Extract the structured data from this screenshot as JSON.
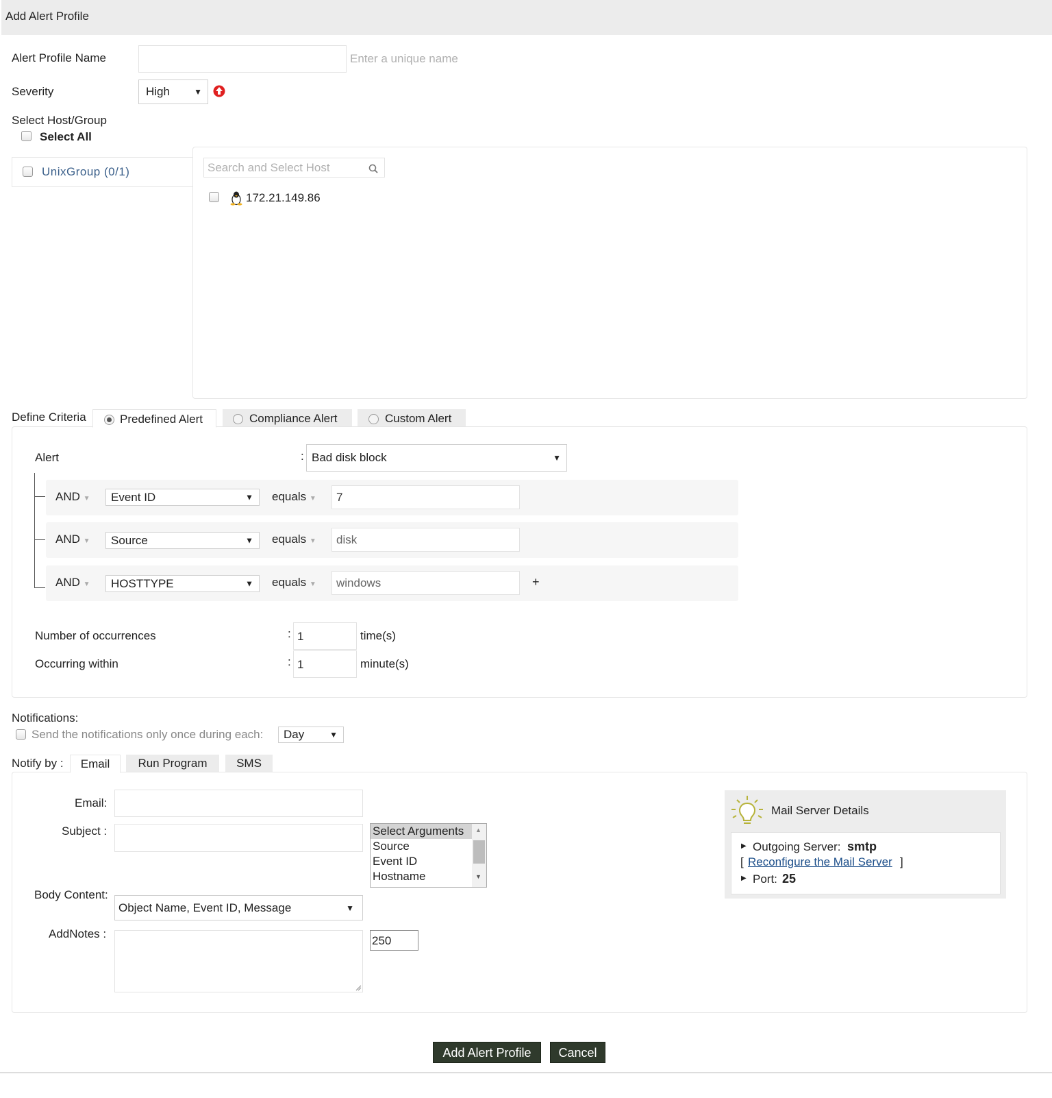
{
  "header": {
    "title": "Add Alert Profile"
  },
  "form": {
    "profile_name_label": "Alert Profile Name",
    "profile_name_value": "",
    "profile_name_hint": "Enter a unique name",
    "severity_label": "Severity",
    "severity_value": "High",
    "select_host_label": "Select Host/Group",
    "select_all_label": "Select All"
  },
  "groups": [
    {
      "label": "UnixGroup (0/1)"
    }
  ],
  "hosts": {
    "search_placeholder": "Search and Select Host",
    "items": [
      {
        "label": "172.21.149.86",
        "os": "linux"
      }
    ]
  },
  "criteria": {
    "label": "Define Criteria",
    "tabs": [
      {
        "label": "Predefined Alert",
        "selected": true
      },
      {
        "label": "Compliance Alert",
        "selected": false
      },
      {
        "label": "Custom Alert",
        "selected": false
      }
    ],
    "alert_label": "Alert",
    "alert_value": "Bad disk block",
    "conditions": [
      {
        "join": "AND",
        "field": "Event ID",
        "op": "equals",
        "value": "7"
      },
      {
        "join": "AND",
        "field": "Source",
        "op": "equals",
        "value": "disk"
      },
      {
        "join": "AND",
        "field": "HOSTTYPE",
        "op": "equals",
        "value": "windows"
      }
    ],
    "add_symbol": "+",
    "occurrences_label": "Number of occurrences",
    "occurrences_value": "1",
    "occurrences_unit": "time(s)",
    "within_label": "Occurring within",
    "within_value": "1",
    "within_unit": "minute(s)",
    "colon": ":"
  },
  "notifications": {
    "label": "Notifications:",
    "once_label": "Send the notifications only once during each:",
    "once_value": "Day"
  },
  "notify": {
    "label": "Notify by :",
    "tabs": [
      {
        "label": "Email",
        "selected": true
      },
      {
        "label": "Run Program",
        "selected": false
      },
      {
        "label": "SMS",
        "selected": false
      }
    ],
    "email_label": "Email:",
    "subject_label": "Subject :",
    "body_label": "Body Content:",
    "body_value": "Object Name, Event ID, Message",
    "notes_label": "AddNotes :",
    "notes_count": "250",
    "arguments": [
      "Select Arguments",
      "Source",
      "Event ID",
      "Hostname"
    ]
  },
  "mail_server": {
    "title": "Mail Server Details",
    "outgoing_label": "Outgoing Server:",
    "outgoing_value": "smtp",
    "bracket_open": "[",
    "reconfigure_label": "Reconfigure the Mail Server",
    "bracket_close": "]",
    "port_label": "Port:",
    "port_value": "25"
  },
  "actions": {
    "submit_label": "Add Alert Profile",
    "cancel_label": "Cancel"
  },
  "colors": {
    "button_bg": "#2f3a2c",
    "warning": "#e02020",
    "bulb": "#b7b33a",
    "link": "#1d4f8a"
  }
}
